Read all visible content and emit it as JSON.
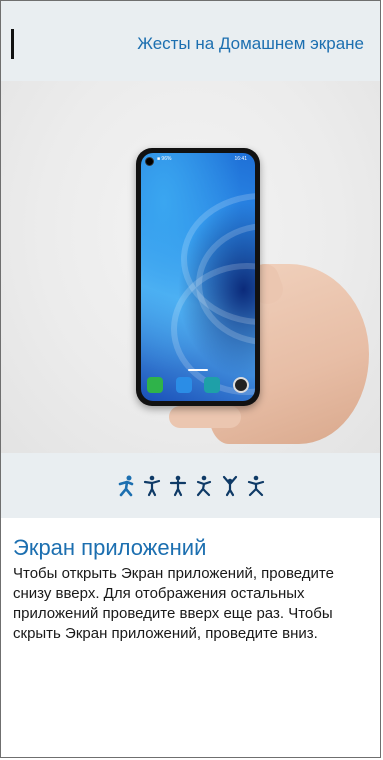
{
  "header": {
    "title": "Жесты на Домашнем экране"
  },
  "phone_status": {
    "battery": "■ 96%",
    "time": "16:41"
  },
  "gestures": [
    {
      "icon": "gesture-swipe-up-icon",
      "active": true
    },
    {
      "icon": "gesture-figure-2-icon",
      "active": false
    },
    {
      "icon": "gesture-figure-3-icon",
      "active": false
    },
    {
      "icon": "gesture-figure-4-icon",
      "active": false
    },
    {
      "icon": "gesture-figure-5-icon",
      "active": false
    },
    {
      "icon": "gesture-figure-6-icon",
      "active": false
    }
  ],
  "section": {
    "title": "Экран приложений",
    "description": "Чтобы открыть Экран приложений, проведите снизу вверх. Для отображения остальных приложений проведите вверх еще раз. Чтобы скрыть Экран приложений, проведите вниз."
  },
  "colors": {
    "accent": "#1c6fb0",
    "header_bg": "#e9eef1",
    "active_icon": "#1c6fb0",
    "inactive_icon": "#0f3a66"
  }
}
